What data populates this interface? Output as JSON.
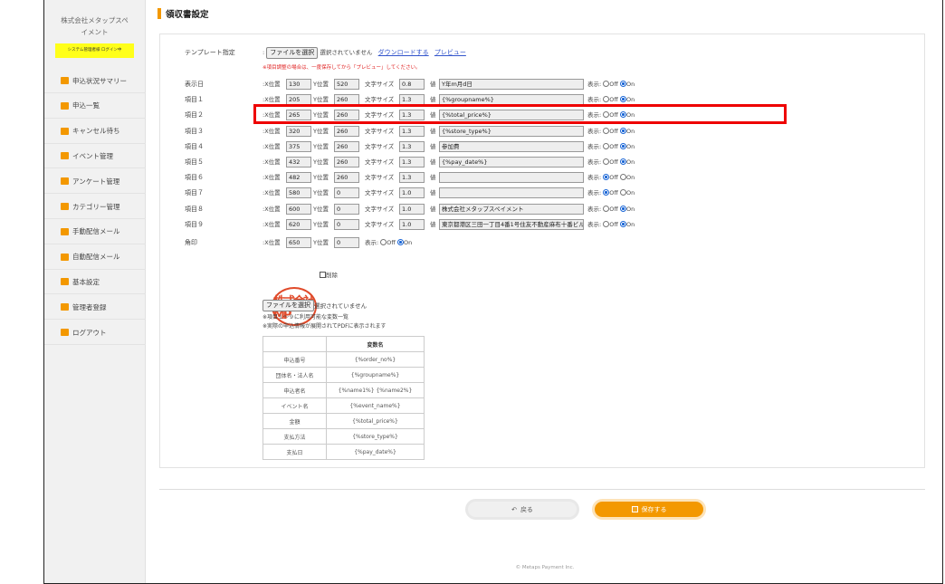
{
  "sidebar": {
    "company": "株式会社メタップスペイメント",
    "company_line1": "株式会社メタップスペ",
    "company_line2": "イメント",
    "system_badge": "システム管理者様 ログイン中",
    "items": [
      {
        "label": "申込状況サマリー",
        "icon": "bar-chart-icon",
        "color": "#f39800"
      },
      {
        "label": "申込一覧",
        "icon": "book-icon",
        "color": "#f39800"
      },
      {
        "label": "キャンセル待ち",
        "icon": "clock-icon",
        "color": "#f39800"
      },
      {
        "label": "イベント管理",
        "icon": "grid-icon",
        "color": "#f39800"
      },
      {
        "label": "アンケート管理",
        "icon": "pie-icon",
        "color": "#f39800"
      },
      {
        "label": "カテゴリー管理",
        "icon": "list-icon",
        "color": "#f39800"
      },
      {
        "label": "手動配信メール",
        "icon": "rss-icon",
        "color": "#f39800"
      },
      {
        "label": "自動配信メール",
        "icon": "envelope-icon",
        "color": "#f39800"
      },
      {
        "label": "基本設定",
        "icon": "gear-icon",
        "color": "#f39800"
      },
      {
        "label": "管理者登録",
        "icon": "users-icon",
        "color": "#f39800"
      },
      {
        "label": "ログアウト",
        "icon": "logout-icon",
        "color": "#f39800"
      }
    ]
  },
  "page": {
    "title": "領収書設定"
  },
  "template": {
    "label": "テンプレート指定",
    "file_button": "ファイルを選択",
    "file_status": "選択されていません",
    "download_link": "ダウンロードする",
    "preview_link": "プレビュー",
    "note": "※項目調整の場合は、一度保存してから「プレビュー」してください。"
  },
  "field_labels": {
    "x": "X位置",
    "y": "Y位置",
    "size": "文字サイズ",
    "value": "値",
    "display": "表示:",
    "off": "Off",
    "on": "On"
  },
  "rows": [
    {
      "label": "表示日",
      "x": "130",
      "y": "520",
      "size": "0.8",
      "value": "Y年m月d日",
      "on": true
    },
    {
      "label": "項目１",
      "x": "205",
      "y": "260",
      "size": "1.3",
      "value": "{%groupname%}",
      "on": true
    },
    {
      "label": "項目２",
      "x": "265",
      "y": "260",
      "size": "1.3",
      "value": "{%total_price%}",
      "on": true
    },
    {
      "label": "項目３",
      "x": "320",
      "y": "260",
      "size": "1.3",
      "value": "{%store_type%}",
      "on": true
    },
    {
      "label": "項目４",
      "x": "375",
      "y": "260",
      "size": "1.3",
      "value": "参加費",
      "on": true
    },
    {
      "label": "項目５",
      "x": "432",
      "y": "260",
      "size": "1.3",
      "value": "{%pay_date%}",
      "on": true
    },
    {
      "label": "項目６",
      "x": "482",
      "y": "260",
      "size": "1.3",
      "value": "",
      "on": false
    },
    {
      "label": "項目７",
      "x": "580",
      "y": "0",
      "size": "1.0",
      "value": "",
      "on": false
    },
    {
      "label": "項目８",
      "x": "600",
      "y": "0",
      "size": "1.0",
      "value": "株式会社メタップスペイメント",
      "on": true
    },
    {
      "label": "項目９",
      "x": "620",
      "y": "0",
      "size": "1.0",
      "value": "東京都港区三田一丁目4番1号住友不動産麻布十番ビル",
      "on": true
    }
  ],
  "seal": {
    "label": "角印",
    "x": "650",
    "y": "0",
    "on": true,
    "stamp_text": "株式会社MP",
    "delete_label": "削除",
    "file_button": "ファイルを選択",
    "file_status": "選択されていません",
    "note1": "※項目１～９に利用可能な変数一覧",
    "note2": "※実際の申込情報が展開されてPDFに表示されます"
  },
  "variables": {
    "header": "変数名",
    "rows": [
      {
        "name": "申込番号",
        "var": "{%order_no%}"
      },
      {
        "name": "団体名・法人名",
        "var": "{%groupname%}"
      },
      {
        "name": "申込者名",
        "var": "{%name1%} {%name2%}"
      },
      {
        "name": "イベント名",
        "var": "{%event_name%}"
      },
      {
        "name": "金額",
        "var": "{%total_price%}"
      },
      {
        "name": "支払方法",
        "var": "{%store_type%}"
      },
      {
        "name": "支払日",
        "var": "{%pay_date%}"
      }
    ]
  },
  "buttons": {
    "back": "戻る",
    "save": "保存する"
  },
  "footer": "© Metaps Payment Inc.",
  "colors": {
    "accent": "#f39800",
    "highlight": "#e00000"
  }
}
